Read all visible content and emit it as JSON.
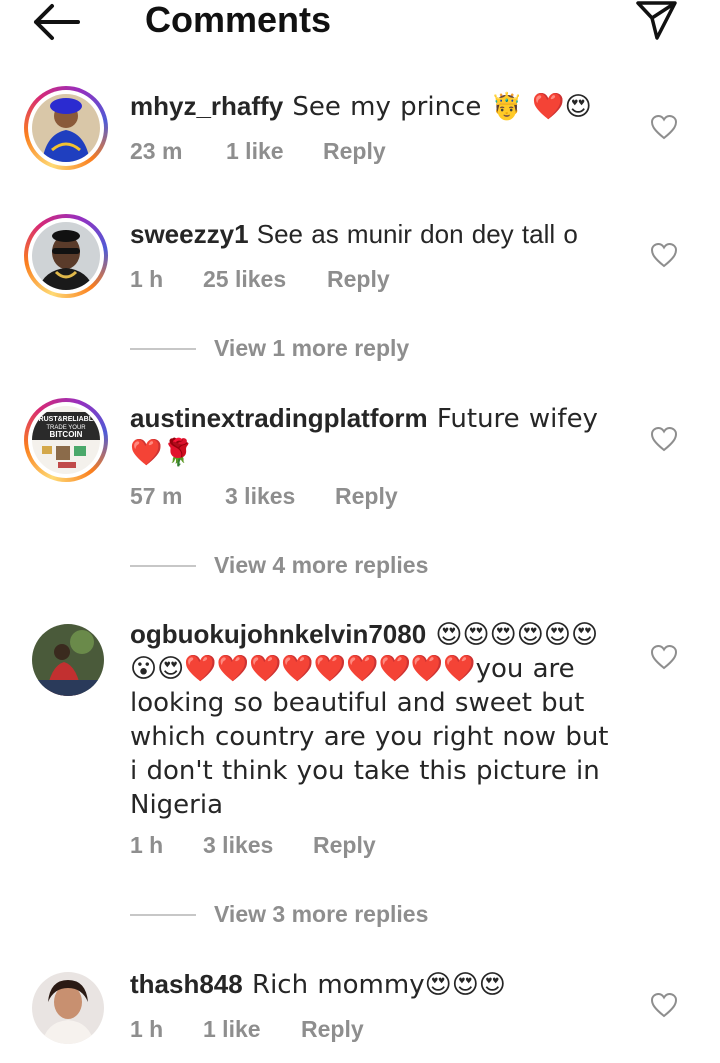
{
  "header": {
    "title": "Comments",
    "back_icon": "arrow-left-icon",
    "send_icon": "paper-plane-icon"
  },
  "comments": [
    {
      "username": "mhyz_rhaffy",
      "text": " See my prince 🤴 ❤️😍",
      "time": "23 m",
      "likes": "1 like",
      "reply": "Reply",
      "has_story_ring": true
    },
    {
      "username": "sweezzy1",
      "text": " See as munir don dey tall o",
      "time": "1 h",
      "likes": "25 likes",
      "reply": "Reply",
      "has_story_ring": true,
      "view_replies": "View 1 more reply"
    },
    {
      "username": "austinextradingplatform",
      "text": " Future wifey ❤️🌹",
      "time": "57 m",
      "likes": "3 likes",
      "reply": "Reply",
      "has_story_ring": true,
      "avatar_text": [
        "TRUST&RELIABLE",
        "TRADE YOUR",
        "BITCOIN"
      ],
      "view_replies": "View 4 more replies"
    },
    {
      "username": "ogbuokujohnkelvin7080",
      "text": " 😍😍😍😍😍😍😮😍❤️❤️❤️❤️❤️❤️❤️❤️❤️you are looking so beautiful and sweet but which country are you right now but i don't think you take this picture in Nigeria",
      "time": "1 h",
      "likes": "3 likes",
      "reply": "Reply",
      "has_story_ring": false,
      "view_replies": "View 3 more replies"
    },
    {
      "username": "thash848",
      "text": " Rich mommy😍😍😍",
      "time": "1 h",
      "likes": "1 like",
      "reply": "Reply",
      "has_story_ring": false
    }
  ],
  "colors": {
    "text": "#262626",
    "secondary": "#8e8e8e",
    "divider": "#c7c7c7",
    "heart_outline": "#8e8e8e"
  }
}
